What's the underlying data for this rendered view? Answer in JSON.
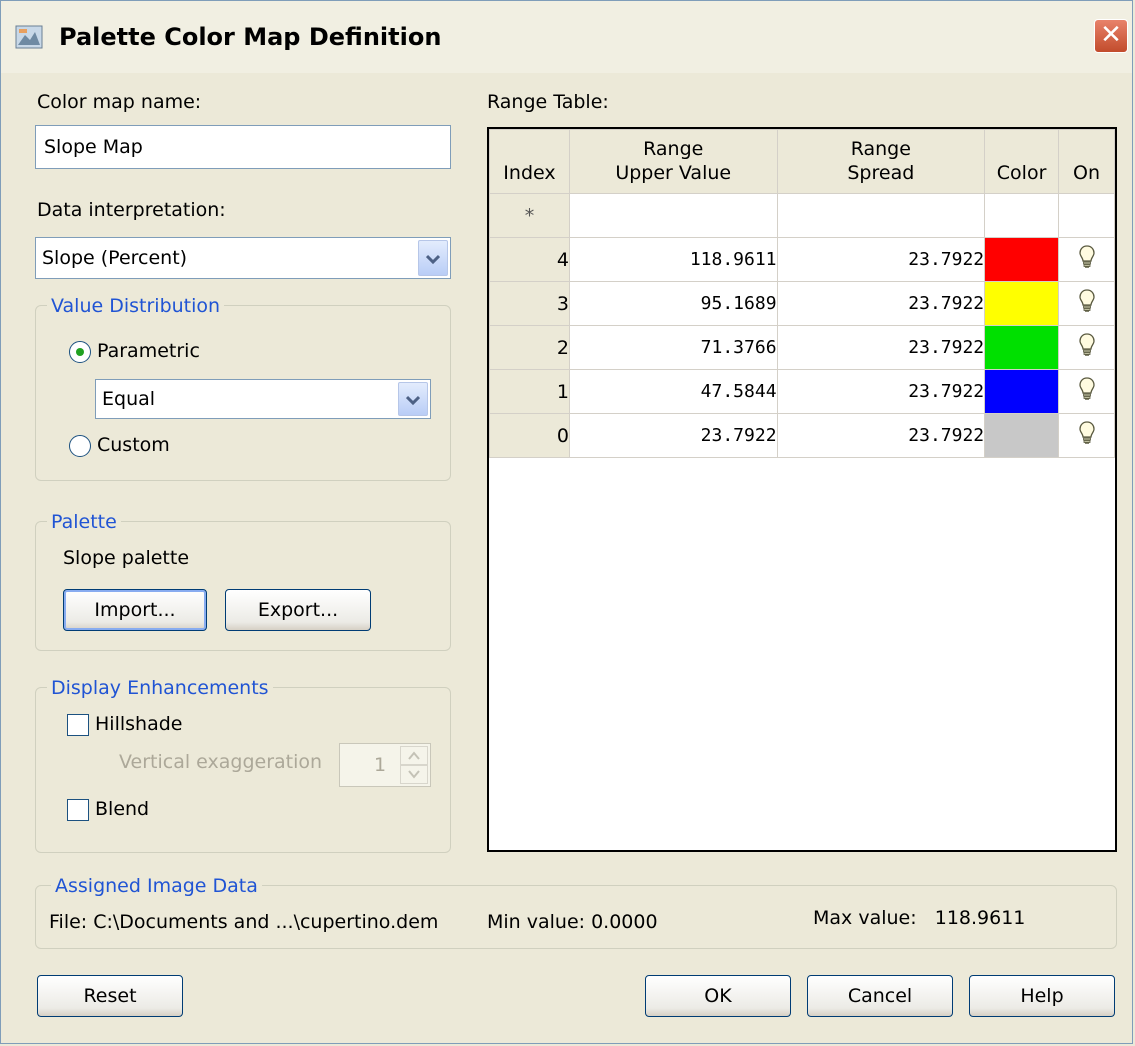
{
  "window": {
    "title": "Palette Color Map Definition",
    "close_glyph": "✕"
  },
  "left": {
    "color_map_name_label": "Color map name:",
    "color_map_name_value": "Slope Map",
    "data_interpretation_label": "Data interpretation:",
    "data_interpretation_value": "Slope (Percent)"
  },
  "value_distribution": {
    "title": "Value Distribution",
    "parametric_label": "Parametric",
    "parametric_selected": true,
    "method_value": "Equal",
    "custom_label": "Custom"
  },
  "palette": {
    "title": "Palette",
    "name": "Slope palette",
    "import_label": "Import...",
    "export_label": "Export..."
  },
  "display_enhancements": {
    "title": "Display Enhancements",
    "hillshade_label": "Hillshade",
    "vertical_exaggeration_label": "Vertical exaggeration",
    "vertical_exaggeration_value": "1",
    "blend_label": "Blend"
  },
  "range_table": {
    "label": "Range Table:",
    "headers": {
      "index": "Index",
      "upper_line1": "Range",
      "upper_line2": "Upper Value",
      "spread_line1": "Range",
      "spread_line2": "Spread",
      "color": "Color",
      "on": "On"
    },
    "new_row_marker": "*",
    "rows": [
      {
        "index": "4",
        "upper": "118.9611",
        "spread": "23.7922",
        "color": "#ff0000"
      },
      {
        "index": "3",
        "upper": "95.1689",
        "spread": "23.7922",
        "color": "#ffff00"
      },
      {
        "index": "2",
        "upper": "71.3766",
        "spread": "23.7922",
        "color": "#00e000"
      },
      {
        "index": "1",
        "upper": "47.5844",
        "spread": "23.7922",
        "color": "#0000ff"
      },
      {
        "index": "0",
        "upper": "23.7922",
        "spread": "23.7922",
        "color": "#c8c8c8"
      }
    ]
  },
  "assigned_image_data": {
    "title": "Assigned Image Data",
    "file": "File: C:\\Documents and ...\\cupertino.dem",
    "min_value": "Min value: 0.0000",
    "max_value": "Max value:   118.9611"
  },
  "buttons": {
    "reset": "Reset",
    "ok": "OK",
    "cancel": "Cancel",
    "help": "Help"
  }
}
